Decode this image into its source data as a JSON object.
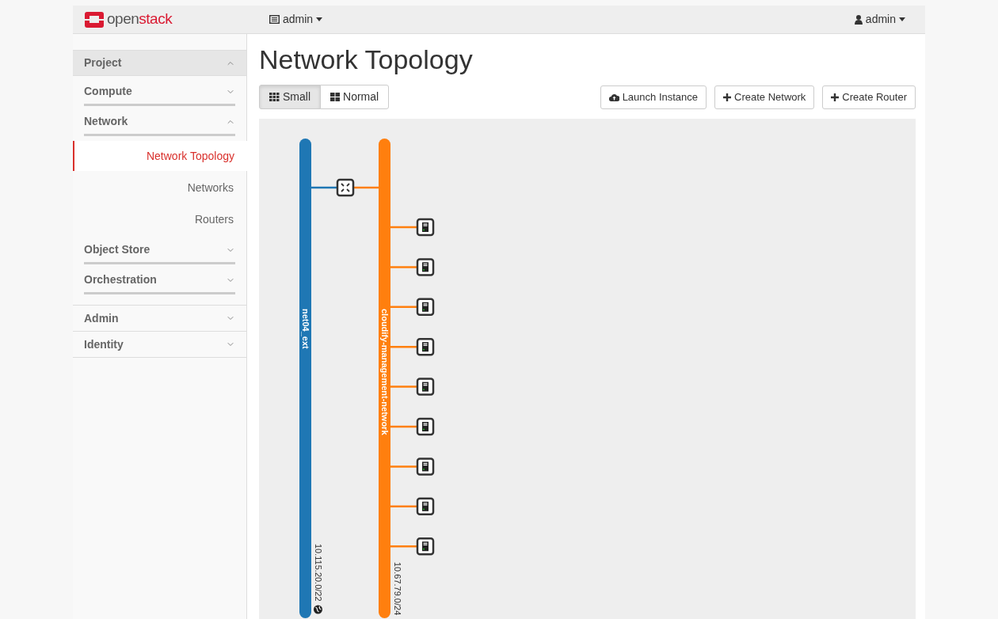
{
  "topbar": {
    "brand_prefix": "open",
    "brand_suffix": "stack",
    "project_menu": "admin",
    "user_menu": "admin"
  },
  "sidebar": {
    "items": [
      {
        "label": "Project",
        "expanded": true,
        "children": [
          {
            "label": "Compute",
            "expanded": false
          },
          {
            "label": "Network",
            "expanded": true,
            "children": [
              {
                "label": "Network Topology",
                "selected": true
              },
              {
                "label": "Networks",
                "selected": false
              },
              {
                "label": "Routers",
                "selected": false
              }
            ]
          },
          {
            "label": "Object Store",
            "expanded": false
          },
          {
            "label": "Orchestration",
            "expanded": false
          }
        ]
      },
      {
        "label": "Admin",
        "expanded": false
      },
      {
        "label": "Identity",
        "expanded": false
      }
    ]
  },
  "page": {
    "title": "Network Topology"
  },
  "view_toggle": [
    {
      "label": "Small",
      "kind": "small",
      "selected": true
    },
    {
      "label": "Normal",
      "kind": "normal",
      "selected": false
    }
  ],
  "actions": [
    {
      "label": "Launch Instance",
      "kind": "launch"
    },
    {
      "label": "Create Network",
      "kind": "create"
    },
    {
      "label": "Create Router",
      "kind": "create"
    }
  ],
  "topology": {
    "networks": [
      {
        "name": "net04_ext",
        "cidr": "10.115.20.0/22",
        "color": "#1f77b4",
        "external": true
      },
      {
        "name": "cloudify-management-network",
        "cidr": "10.67.79.0/24",
        "color": "#ff7f0e",
        "external": false
      }
    ],
    "nodes": [
      {
        "kind": "router"
      },
      {
        "kind": "instance"
      },
      {
        "kind": "instance"
      },
      {
        "kind": "instance"
      },
      {
        "kind": "instance"
      },
      {
        "kind": "instance"
      },
      {
        "kind": "instance"
      },
      {
        "kind": "instance"
      },
      {
        "kind": "instance"
      },
      {
        "kind": "instance"
      }
    ]
  }
}
